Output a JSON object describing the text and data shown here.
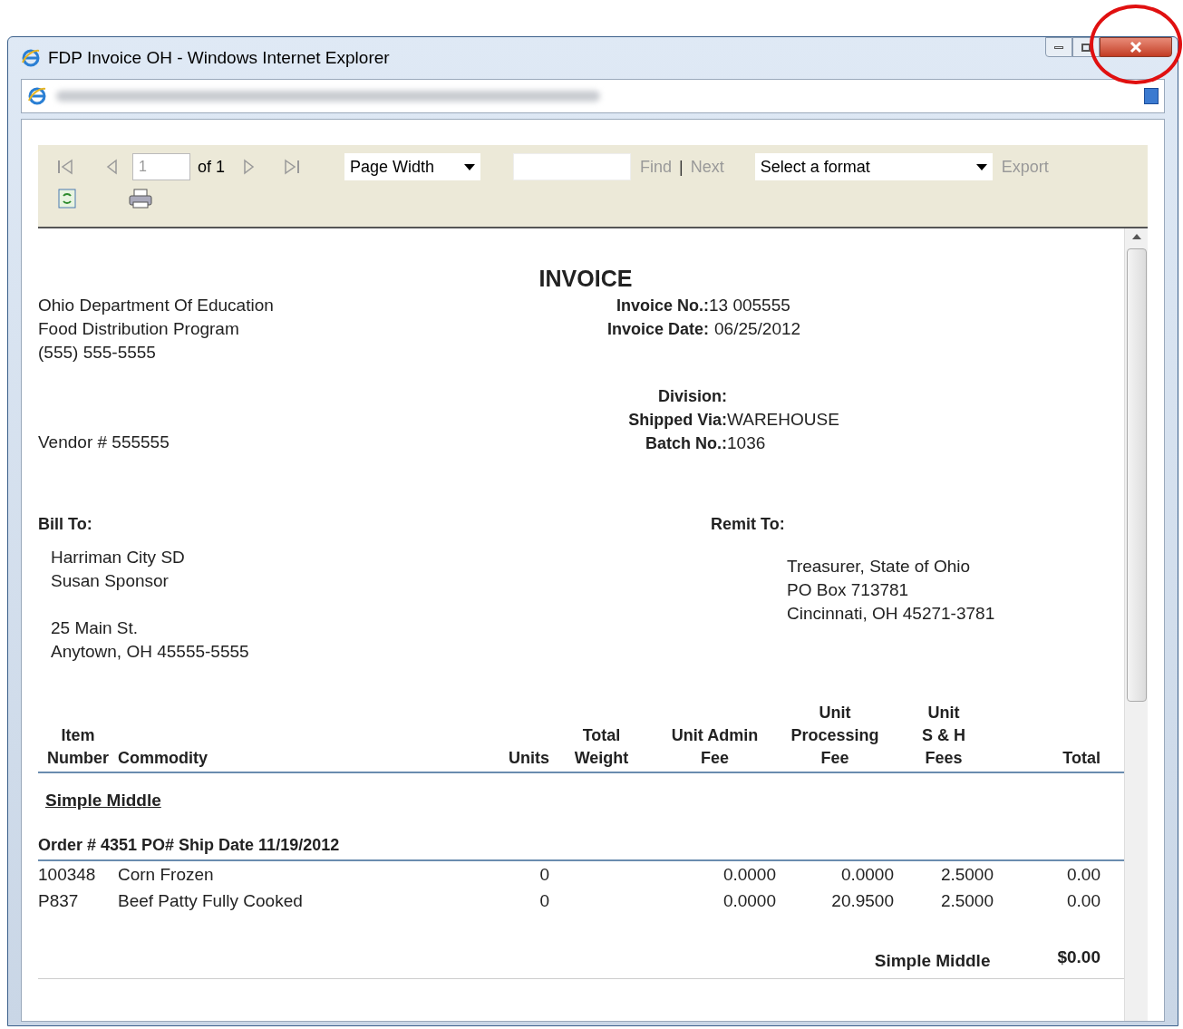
{
  "window": {
    "title": "FDP Invoice OH - Windows Internet Explorer"
  },
  "toolbar": {
    "page": "1",
    "page_of": "of 1",
    "zoom": "Page Width",
    "find": "Find",
    "separator": "|",
    "next": "Next",
    "format": "Select a format",
    "export": "Export"
  },
  "report": {
    "title": "INVOICE",
    "sender_lines": [
      "Ohio Department Of Education",
      "Food Distribution Program",
      "(555) 555-5555"
    ],
    "invoice_fields": [
      {
        "label": "Invoice No.:",
        "value": "13 005555"
      },
      {
        "label": "Invoice Date:",
        "value": "06/25/2012"
      }
    ],
    "vendor": "Vendor # 555555",
    "shipping_fields": [
      {
        "label": "Division:"
      },
      {
        "label": "Shipped Via:",
        "value": "WAREHOUSE"
      },
      {
        "label": "Batch No.:",
        "value": "1036"
      }
    ],
    "bill_to": {
      "label": "Bill To:",
      "lines": [
        "Harriman City SD",
        "Susan Sponsor"
      ],
      "address_lines": [
        "25 Main St.",
        "Anytown, OH 45555-5555"
      ]
    },
    "remit_to": {
      "label": "Remit To:",
      "lines": [
        "Treasurer, State of Ohio",
        "PO Box 713781",
        "Cincinnati, OH 45271-3781"
      ]
    },
    "table": {
      "columns": [
        "Item\nNumber",
        "Commodity",
        "Units",
        "Total\nWeight",
        "Unit Admin\nFee",
        "Unit\nProcessing\nFee",
        "Unit\nS & H\nFees",
        "Total"
      ],
      "group": "Simple Middle",
      "order": "Order # 4351 PO# Ship Date 11/19/2012",
      "rows": [
        [
          "100348",
          "Corn Frozen",
          "0",
          null,
          "0.0000",
          "0.0000",
          "2.5000",
          "0.00"
        ],
        [
          "P837",
          "Beef Patty Fully Cooked",
          "0",
          null,
          "0.0000",
          "20.9500",
          "2.5000",
          "0.00"
        ]
      ],
      "subtotal_label": "Simple Middle",
      "subtotal_value": "$0.00"
    }
  }
}
